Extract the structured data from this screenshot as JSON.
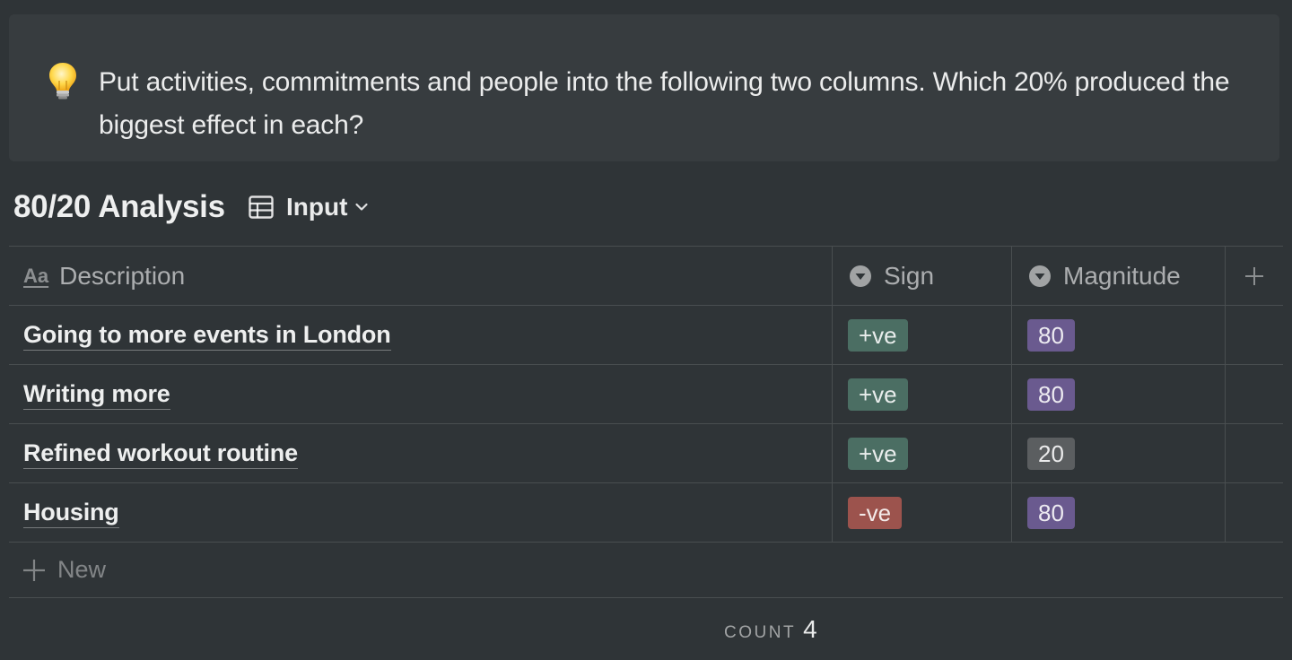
{
  "callout": {
    "icon": "lightbulb-icon",
    "text": "Put activities, commitments and people into the following two columns. Which 20% produced the biggest effect in each?"
  },
  "database": {
    "title": "80/20 Analysis",
    "view": {
      "icon": "table-icon",
      "label": "Input"
    }
  },
  "table": {
    "columns": [
      {
        "label": "Description",
        "icon": "text-property-icon"
      },
      {
        "label": "Sign",
        "icon": "select-property-icon"
      },
      {
        "label": "Magnitude",
        "icon": "select-property-icon"
      }
    ],
    "rows": [
      {
        "description": "Going to more events in London",
        "sign": "+ve",
        "magnitude": "80"
      },
      {
        "description": "Writing more",
        "sign": "+ve",
        "magnitude": "80"
      },
      {
        "description": "Refined workout routine",
        "sign": "+ve",
        "magnitude": "20"
      },
      {
        "description": "Housing",
        "sign": "-ve",
        "magnitude": "80"
      }
    ],
    "new_label": "New"
  },
  "footer": {
    "count_label": "COUNT",
    "count_value": "4"
  },
  "colors": {
    "background": "#2f3437",
    "callout_bg": "#373c3f",
    "tag_positive": "#4b6e63",
    "tag_negative": "#9c534d",
    "tag_purple": "#6a5a8f",
    "tag_gray": "#5b5e60"
  }
}
